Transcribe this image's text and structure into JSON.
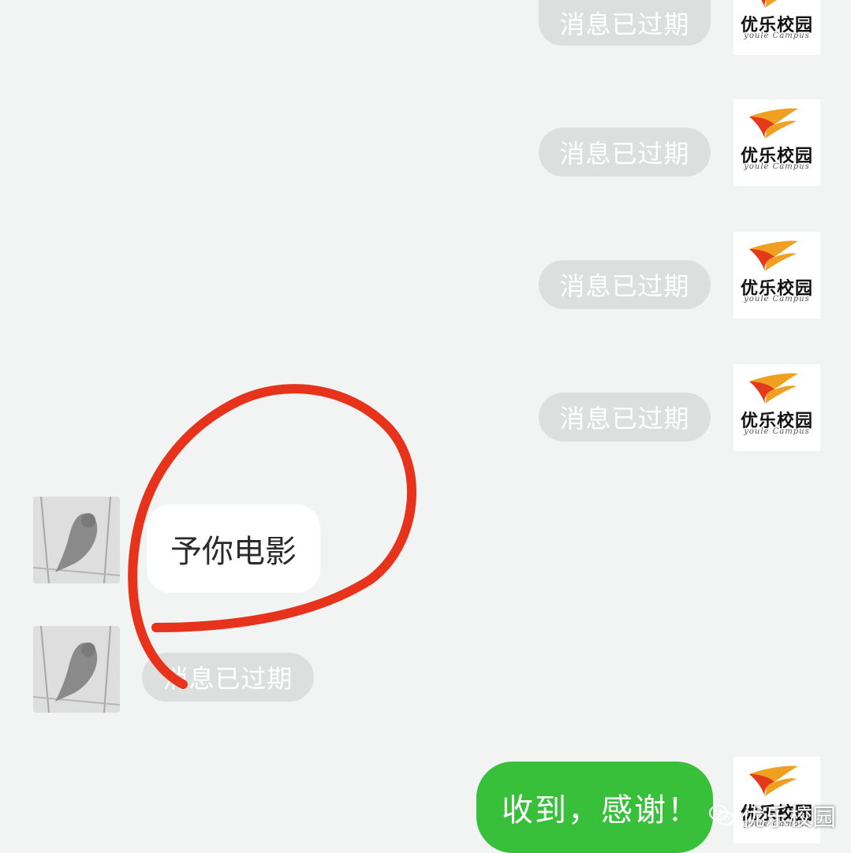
{
  "messages": {
    "expired_label": "消息已过期",
    "left_text": "予你电影",
    "reply": "收到，感谢！"
  },
  "logo": {
    "name": "优乐校园",
    "subtitle": "youle Campus"
  },
  "watermark": {
    "text": "优乐校园",
    "icon": "wechat-icon"
  },
  "colors": {
    "background": "#f1f4f3",
    "expired_bubble": "#dcdfde",
    "sent_bubble": "#38c03a",
    "annotation": "#e8331c"
  }
}
